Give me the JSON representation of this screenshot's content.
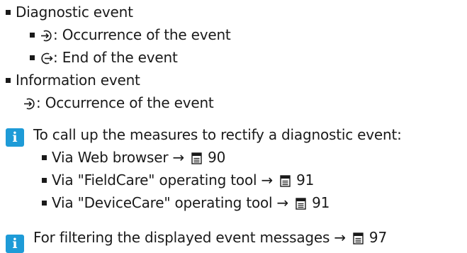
{
  "list": {
    "diagnostic_event": "Diagnostic event",
    "occurrence": ": Occurrence of the event",
    "end": ": End of the event",
    "information_event": "Information event",
    "info_occurrence": ": Occurrence of the event"
  },
  "note1": {
    "intro": "To call up the measures to rectify a diagnostic event:",
    "items": [
      {
        "text": "Via Web browser →",
        "page": "90"
      },
      {
        "text": "Via \"FieldCare\" operating tool →",
        "page": "91"
      },
      {
        "text": "Via \"DeviceCare\" operating tool →",
        "page": "91"
      }
    ]
  },
  "note2": {
    "text": "For filtering the displayed event messages →",
    "page": "97"
  },
  "colors": {
    "info_icon": "#1e9bd7",
    "text": "#1a1a1a"
  },
  "icons": {
    "occurrence": "event-occurrence-icon",
    "end": "event-end-icon",
    "info": "info-icon",
    "page_ref": "document-page-icon"
  }
}
